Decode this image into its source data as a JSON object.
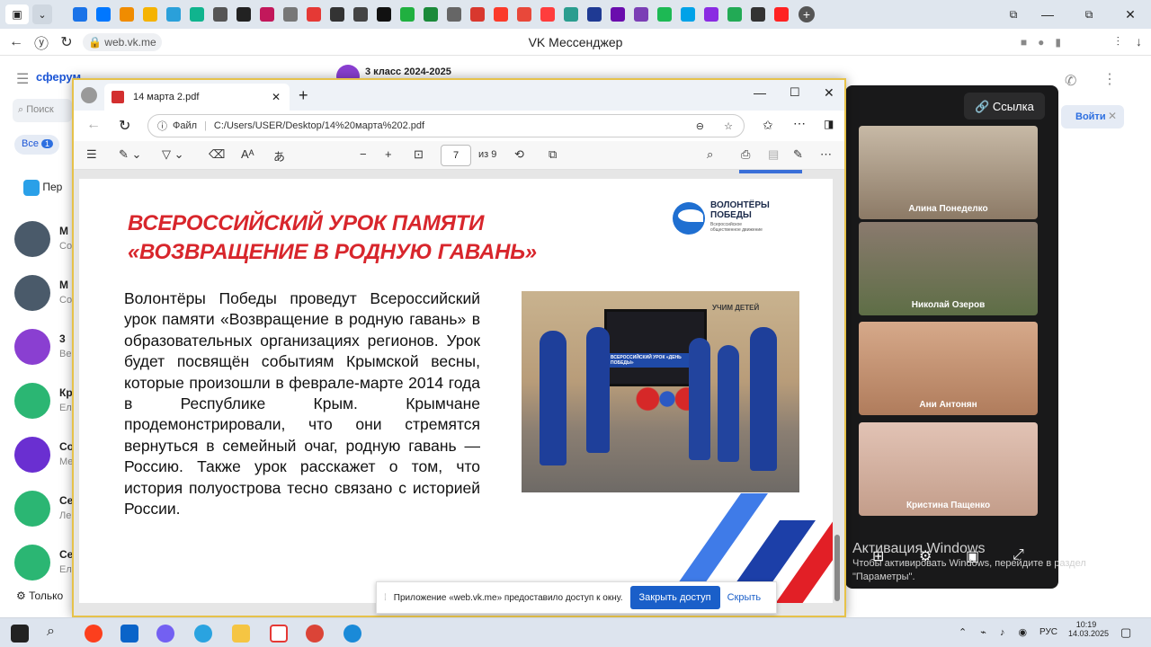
{
  "browser": {
    "title": "VK Мессенджер",
    "url": "web.vk.me",
    "tab_colors": [
      "#1a73e8",
      "#0077ff",
      "#f08c00",
      "#f5b301",
      "#2aa0da",
      "#10b48e",
      "#555555",
      "#222222",
      "#c2185b",
      "#777777",
      "#e53935",
      "#333333",
      "#444444",
      "#111111",
      "#20b040",
      "#1b8a3a",
      "#666666",
      "#d8382e",
      "#fb3b2b",
      "#e8483a",
      "#ff3d3d",
      "#2a9d8f",
      "#1f3a93",
      "#6a0dad",
      "#7b3fb5",
      "#1db954",
      "#00a2e8",
      "#8a2be2",
      "#22aa55",
      "#333333",
      "#ff2222"
    ]
  },
  "vk": {
    "logo": "сферум",
    "search_placeholder": "Поиск",
    "filter_all": "Все",
    "filter_count": "1",
    "folder_label": "Пер",
    "chat_header_title": "3 класс 2024-2025",
    "chat_items": [
      {
        "t": "М",
        "s": "Со"
      },
      {
        "t": "М",
        "s": "Со"
      },
      {
        "t": "3",
        "s": "Ве"
      },
      {
        "t": "Кр",
        "s": "Ел"
      },
      {
        "t": "Со",
        "s": "Ме"
      },
      {
        "t": "Се",
        "s": "Ле"
      },
      {
        "t": "Се",
        "s": "Ел"
      }
    ],
    "bottom_text": "Только",
    "join_button": "Войти"
  },
  "call": {
    "link_button": "Ссылка",
    "participants": [
      "Алина Понеделко",
      "Николай Озеров",
      "Ани Антонян",
      "Кристина Пащенко"
    ]
  },
  "pdf": {
    "tab_title": "14 марта 2.pdf",
    "file_label": "Файл",
    "path": "C:/Users/USER/Desktop/14%20марта%202.pdf",
    "page_current": "7",
    "page_total": "из 9",
    "slide": {
      "title_line1": "ВСЕРОССИЙСКИЙ УРОК ПАМЯТИ",
      "title_line2": "«ВОЗВРАЩЕНИЕ В РОДНУЮ ГАВАНЬ»",
      "logo_line1": "ВОЛОНТЁРЫ",
      "logo_line2": "ПОБЕДЫ",
      "logo_sub1": "Всероссийское",
      "logo_sub2": "общественное движение",
      "body": "Волонтёры Победы проведут Всероссийский урок памяти «Возвращение в родную гавань» в образовательных организациях регионов. Урок будет посвящён событиям Крымской весны, которые произошли в феврале-марте 2014 года в Республике Крым. Крымчане продемонстрировали, что они стремятся вернуться в семейный очаг, родную гавань — Россию. Также урок расскажет о том, что история полуострова тесно связано с историей России.",
      "photo_screen_text": "ВСЕРОССИЙСКИЙ УРОК «ДЕНЬ ПОБЕДЫ»",
      "photo_sign": "УЧИМ ДЕТЕЙ"
    }
  },
  "notification": {
    "text": "Приложение «web.vk.me» предоставило доступ к окну.",
    "stop_button": "Закрыть доступ",
    "hide_button": "Скрыть"
  },
  "windows": {
    "activation_title": "Активация Windows",
    "activation_text": "Чтобы активировать Windows, перейдите в раздел \"Параметры\"."
  },
  "taskbar": {
    "lang": "РУС",
    "time": "10:19",
    "date": "14.03.2025"
  }
}
